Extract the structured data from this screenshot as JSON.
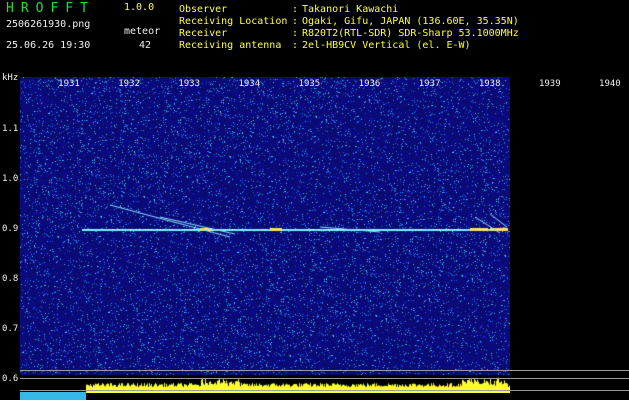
{
  "header": {
    "title": "HROFFT",
    "version": "1.0.0",
    "filename": "2506261930.png",
    "meteor_label": "meteor",
    "datetime": "25.06.26 19:30",
    "meteor_count": "42"
  },
  "info": [
    {
      "label": "Observer",
      "value": "Takanori Kawachi"
    },
    {
      "label": "Receiving Location",
      "value": "Ogaki, Gifu, JAPAN (136.60E, 35.35N)"
    },
    {
      "label": "Receiver",
      "value": "R820T2(RTL-SDR) SDR-Sharp 53.1000MHz"
    },
    {
      "label": "Receiving antenna",
      "value": "2el-HB9CV Vertical (el. E-W)"
    }
  ],
  "info_separator": ":",
  "chart_data": {
    "type": "heatmap",
    "ylabel": "kHz",
    "x_ticks": [
      "1931",
      "1932",
      "1933",
      "1934",
      "1935",
      "1936",
      "1937",
      "1938",
      "1939",
      "1940"
    ],
    "y_ticks": [
      "1.1",
      "1.0",
      "0.9",
      "0.8",
      "0.7",
      "0.6"
    ],
    "ylim": [
      0.6,
      1.1
    ],
    "carrier_frequency_khz": 0.9,
    "colors": {
      "background": "#1a1a8a",
      "carrier": "#7af0ff",
      "signal_bar": "#ffff30",
      "noise_floor": "#35b8e8"
    }
  }
}
